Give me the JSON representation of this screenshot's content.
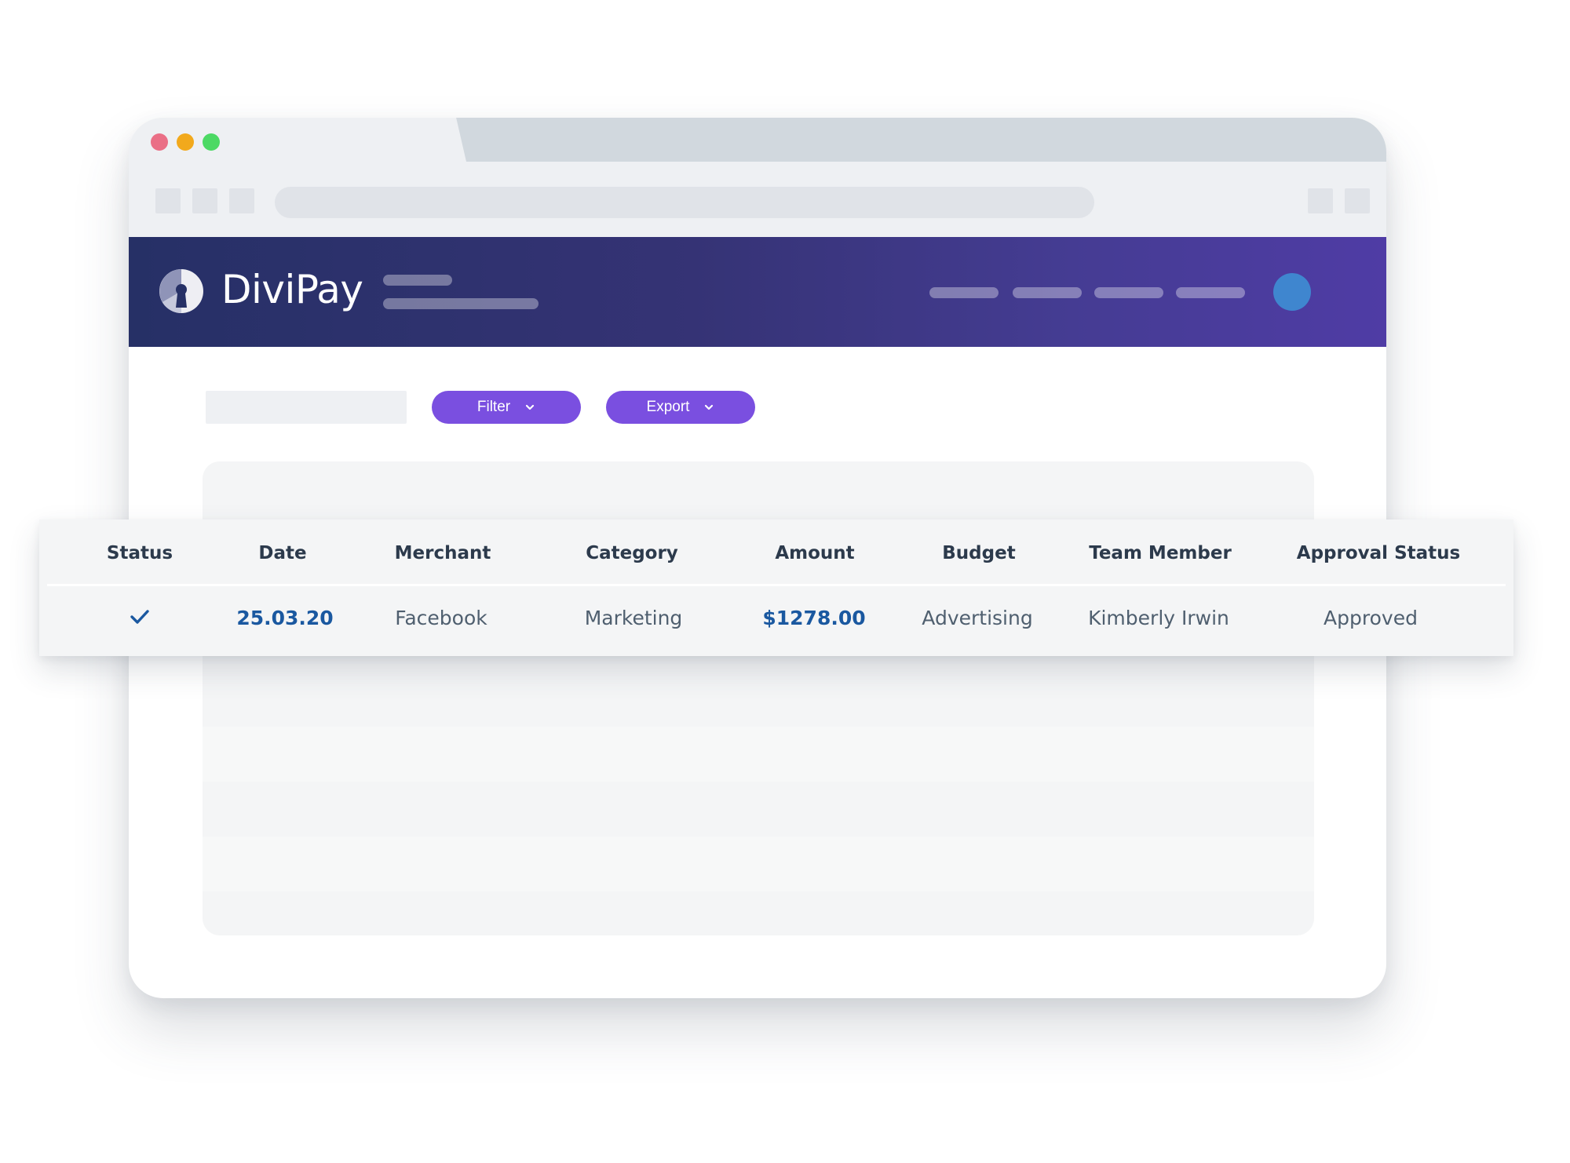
{
  "app": {
    "brand_name": "DiviPay"
  },
  "toolbar": {
    "filter_label": "Filter",
    "export_label": "Export"
  },
  "table": {
    "columns": [
      "Status",
      "Date",
      "Merchant",
      "Category",
      "Amount",
      "Budget",
      "Team Member",
      "Approval Status"
    ],
    "row": {
      "status_icon": "checkmark-icon",
      "date": "25.03.20",
      "merchant": "Facebook",
      "category": "Marketing",
      "amount": "$1278.00",
      "budget": "Advertising",
      "team_member": "Kimberly Irwin",
      "approval_status": "Approved"
    }
  },
  "colors": {
    "header_start": "#263066",
    "header_end": "#4f3ca5",
    "button": "#7a4fe0",
    "accent_text": "#1a58a0",
    "avatar": "#3f86cf"
  }
}
